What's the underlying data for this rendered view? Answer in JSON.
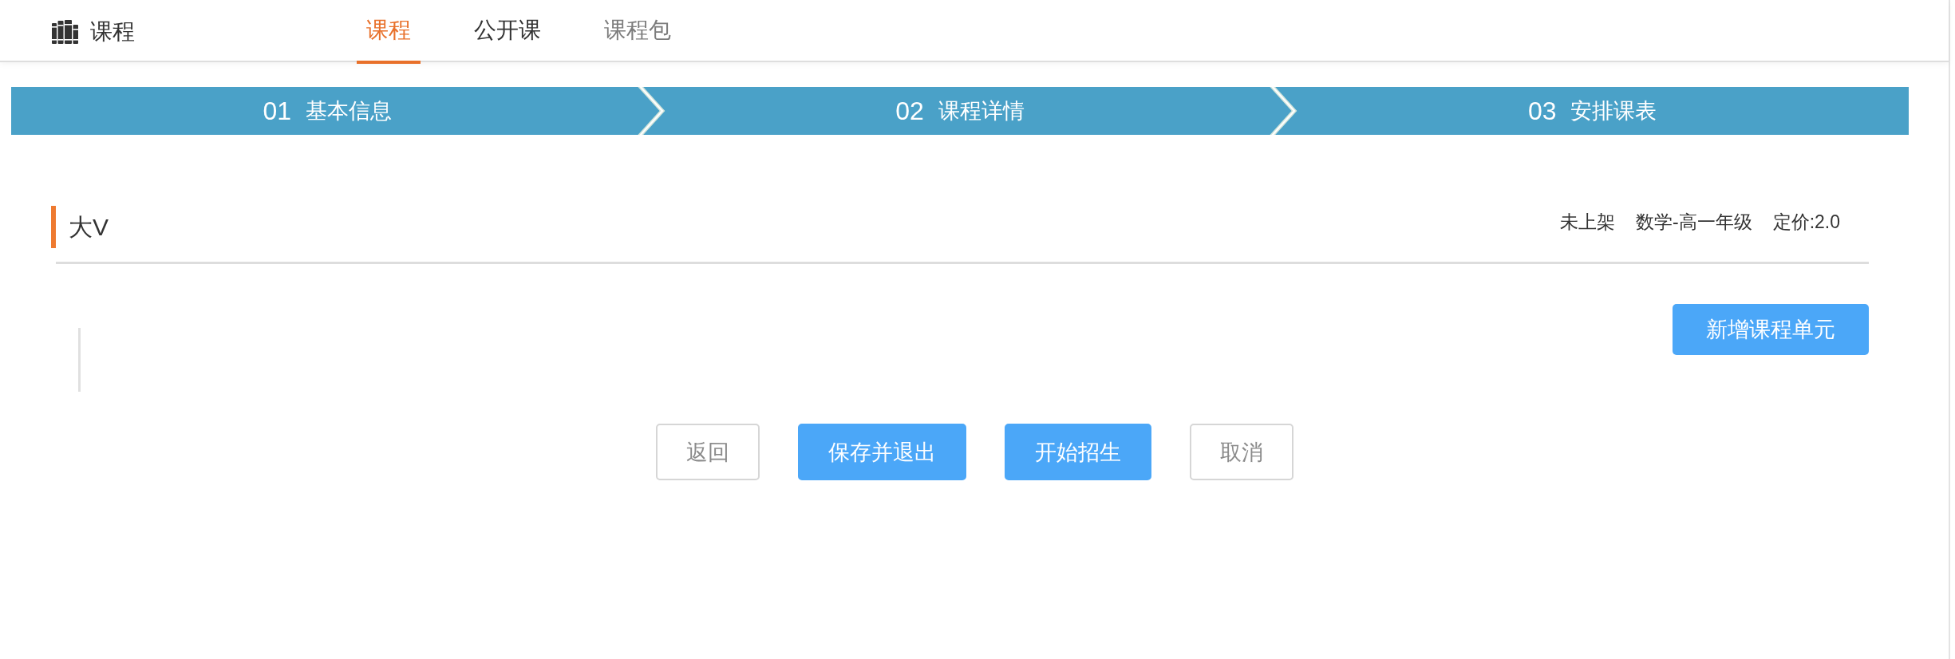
{
  "header": {
    "title": "课程",
    "tabs": [
      {
        "label": "课程",
        "selected": true,
        "disabled": false
      },
      {
        "label": "公开课",
        "selected": false,
        "disabled": false
      },
      {
        "label": "课程包",
        "selected": false,
        "disabled": true
      }
    ]
  },
  "steps": [
    {
      "number": "01",
      "label": "基本信息"
    },
    {
      "number": "02",
      "label": "课程详情"
    },
    {
      "number": "03",
      "label": "安排课表"
    }
  ],
  "course": {
    "title": "大V",
    "status": "未上架",
    "subject": "数学-高一年级",
    "price": "定价:2.0"
  },
  "add_unit_button": "新增课程单元",
  "actions": [
    {
      "label": "返回",
      "kind": "outline"
    },
    {
      "label": "保存并退出",
      "kind": "primary"
    },
    {
      "label": "开始招生",
      "kind": "primary"
    },
    {
      "label": "取消",
      "kind": "outline"
    }
  ]
}
